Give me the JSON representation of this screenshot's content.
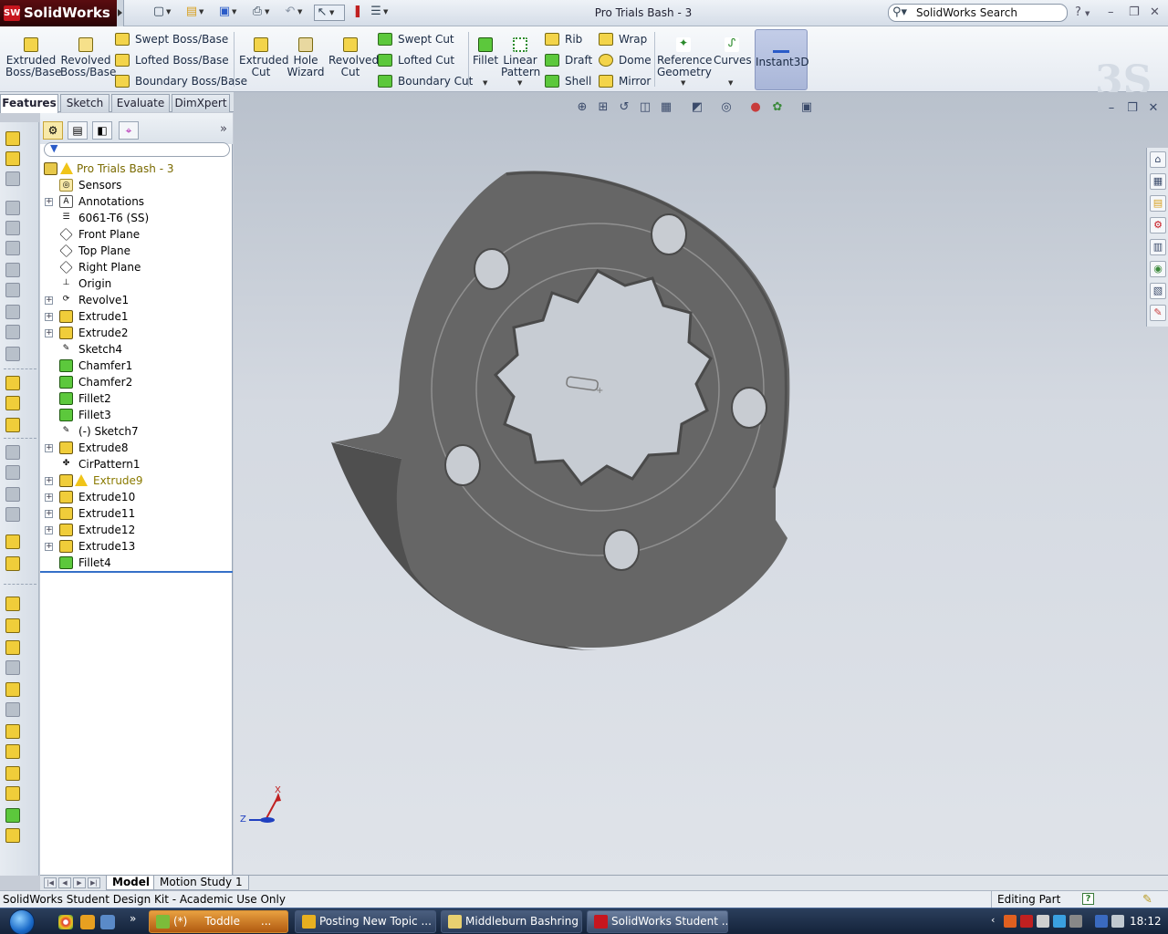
{
  "app": {
    "brand": "SolidWorks",
    "brand_icon_text": "SW",
    "document_title": "Pro Trials Bash - 3",
    "search_placeholder": "SolidWorks Search",
    "window_controls": [
      "?",
      "–",
      "❐",
      "✕"
    ]
  },
  "quick_access": [
    {
      "name": "new-icon",
      "glyph": "🗋"
    },
    {
      "name": "open-icon",
      "glyph": "📂"
    },
    {
      "name": "save-icon",
      "glyph": "💾"
    },
    {
      "name": "print-icon",
      "glyph": "🖨"
    },
    {
      "name": "undo-icon",
      "glyph": "↶"
    },
    {
      "name": "select-icon",
      "glyph": "↖"
    },
    {
      "name": "rebuild-icon",
      "glyph": "🚦"
    },
    {
      "name": "options-icon",
      "glyph": "☰"
    }
  ],
  "command_manager": {
    "extruded_boss": "Extruded\nBoss/Base",
    "revolved_boss": "Revolved\nBoss/Base",
    "swept_boss": "Swept Boss/Base",
    "lofted_boss": "Lofted Boss/Base",
    "boundary_boss": "Boundary Boss/Base",
    "extruded_cut": "Extruded\nCut",
    "hole_wizard": "Hole\nWizard",
    "revolved_cut": "Revolved\nCut",
    "swept_cut": "Swept Cut",
    "lofted_cut": "Lofted Cut",
    "boundary_cut": "Boundary Cut",
    "fillet": "Fillet",
    "linear_pattern": "Linear\nPattern",
    "rib": "Rib",
    "draft": "Draft",
    "shell": "Shell",
    "wrap": "Wrap",
    "dome": "Dome",
    "mirror": "Mirror",
    "reference_geometry": "Reference\nGeometry",
    "curves": "Curves",
    "instant3d": "Instant3D"
  },
  "tabs": [
    "Features",
    "Sketch",
    "Evaluate",
    "DimXpert"
  ],
  "active_tab": "Features",
  "feature_tree": {
    "root": "Pro Trials Bash - 3",
    "items": [
      {
        "label": "Sensors",
        "type": "sensor",
        "expandable": false,
        "warning": false
      },
      {
        "label": "Annotations",
        "type": "annot",
        "expandable": true,
        "warning": false
      },
      {
        "label": "6061-T6 (SS)",
        "type": "material",
        "expandable": false,
        "warning": false
      },
      {
        "label": "Front Plane",
        "type": "plane",
        "expandable": false,
        "warning": false
      },
      {
        "label": "Top Plane",
        "type": "plane",
        "expandable": false,
        "warning": false
      },
      {
        "label": "Right Plane",
        "type": "plane",
        "expandable": false,
        "warning": false
      },
      {
        "label": "Origin",
        "type": "origin",
        "expandable": false,
        "warning": false
      },
      {
        "label": "Revolve1",
        "type": "revolve",
        "expandable": true,
        "warning": false
      },
      {
        "label": "Extrude1",
        "type": "feat",
        "expandable": true,
        "warning": false
      },
      {
        "label": "Extrude2",
        "type": "feat",
        "expandable": true,
        "warning": false
      },
      {
        "label": "Sketch4",
        "type": "sketch",
        "expandable": false,
        "warning": false
      },
      {
        "label": "Chamfer1",
        "type": "fillet",
        "expandable": false,
        "warning": false
      },
      {
        "label": "Chamfer2",
        "type": "fillet",
        "expandable": false,
        "warning": false
      },
      {
        "label": "Fillet2",
        "type": "fillet",
        "expandable": false,
        "warning": false
      },
      {
        "label": "Fillet3",
        "type": "fillet",
        "expandable": false,
        "warning": false
      },
      {
        "label": "(-) Sketch7",
        "type": "sketch",
        "expandable": false,
        "warning": false
      },
      {
        "label": "Extrude8",
        "type": "feat",
        "expandable": true,
        "warning": false
      },
      {
        "label": "CirPattern1",
        "type": "pattern",
        "expandable": false,
        "warning": false
      },
      {
        "label": "Extrude9",
        "type": "feat",
        "expandable": true,
        "warning": true
      },
      {
        "label": "Extrude10",
        "type": "feat",
        "expandable": true,
        "warning": false
      },
      {
        "label": "Extrude11",
        "type": "feat",
        "expandable": true,
        "warning": false
      },
      {
        "label": "Extrude12",
        "type": "feat",
        "expandable": true,
        "warning": false
      },
      {
        "label": "Extrude13",
        "type": "feat",
        "expandable": true,
        "warning": false
      },
      {
        "label": "Fillet4",
        "type": "fillet",
        "expandable": false,
        "warning": false
      }
    ]
  },
  "bottom_tabs": [
    "Model",
    "Motion Study 1"
  ],
  "status": {
    "left": "SolidWorks Student Design Kit - Academic Use Only",
    "mode": "Editing Part",
    "help": "?"
  },
  "triad": {
    "x": "X",
    "z": "Z"
  },
  "taskbar": {
    "items": [
      {
        "label": "(*)     Toddle      ...",
        "style": "orange",
        "icon_color": "#7cbc3a"
      },
      {
        "label": "Posting New Topic ...",
        "style": "normal",
        "icon_color": "#e8b020"
      },
      {
        "label": "Middleburn Bashring",
        "style": "normal",
        "icon_color": "#e8d070"
      },
      {
        "label": "SolidWorks Student ...",
        "style": "active",
        "icon_color": "#c7161e"
      }
    ],
    "clock": "18:12"
  },
  "colors": {
    "part_face": "#646464",
    "part_side": "#505050",
    "viewport_bg": "#c6ccd6",
    "brand_red": "#c7161e"
  }
}
